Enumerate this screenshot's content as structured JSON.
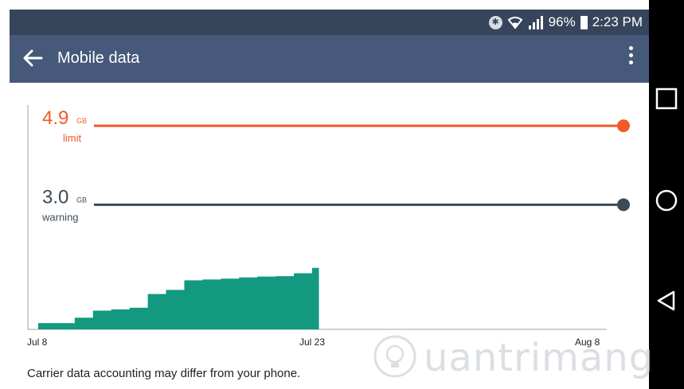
{
  "status_bar": {
    "battery": "96%",
    "time": "2:23 PM",
    "icons": [
      "bluetooth-icon",
      "wifi-icon",
      "signal-icon",
      "battery-icon"
    ]
  },
  "app_bar": {
    "title": "Mobile data",
    "back_icon": "back-arrow-icon",
    "menu_icon": "overflow-menu-icon"
  },
  "nav_bar": {
    "buttons": [
      "recents-square-icon",
      "home-circle-icon",
      "back-triangle-icon"
    ]
  },
  "chart_data": {
    "type": "area",
    "limit": {
      "value": "4.9",
      "unit": "GB",
      "label": "limit",
      "color": "#f05a28"
    },
    "warning": {
      "value": "3.0",
      "unit": "GB",
      "label": "warning",
      "color": "#3e4b56"
    },
    "x_ticks": [
      "Jul 8",
      "Jul 23",
      "Aug 8"
    ],
    "usage_color": "#12997f",
    "usage_days": [
      0,
      1,
      2,
      3,
      4,
      5,
      6,
      7,
      8,
      9,
      10,
      11,
      12,
      13,
      14,
      15
    ],
    "usage_gb": [
      0.15,
      0.15,
      0.28,
      0.45,
      0.48,
      0.52,
      0.85,
      0.95,
      1.18,
      1.2,
      1.22,
      1.25,
      1.27,
      1.28,
      1.35,
      1.48
    ],
    "ylim": [
      0,
      5.4
    ]
  },
  "footer": {
    "note": "Carrier data accounting may differ from your phone."
  },
  "watermark": {
    "text": "uantrimang"
  },
  "colors": {
    "status_bar": "#36455c",
    "app_bar": "#46597a",
    "nav_bar": "#000000"
  }
}
